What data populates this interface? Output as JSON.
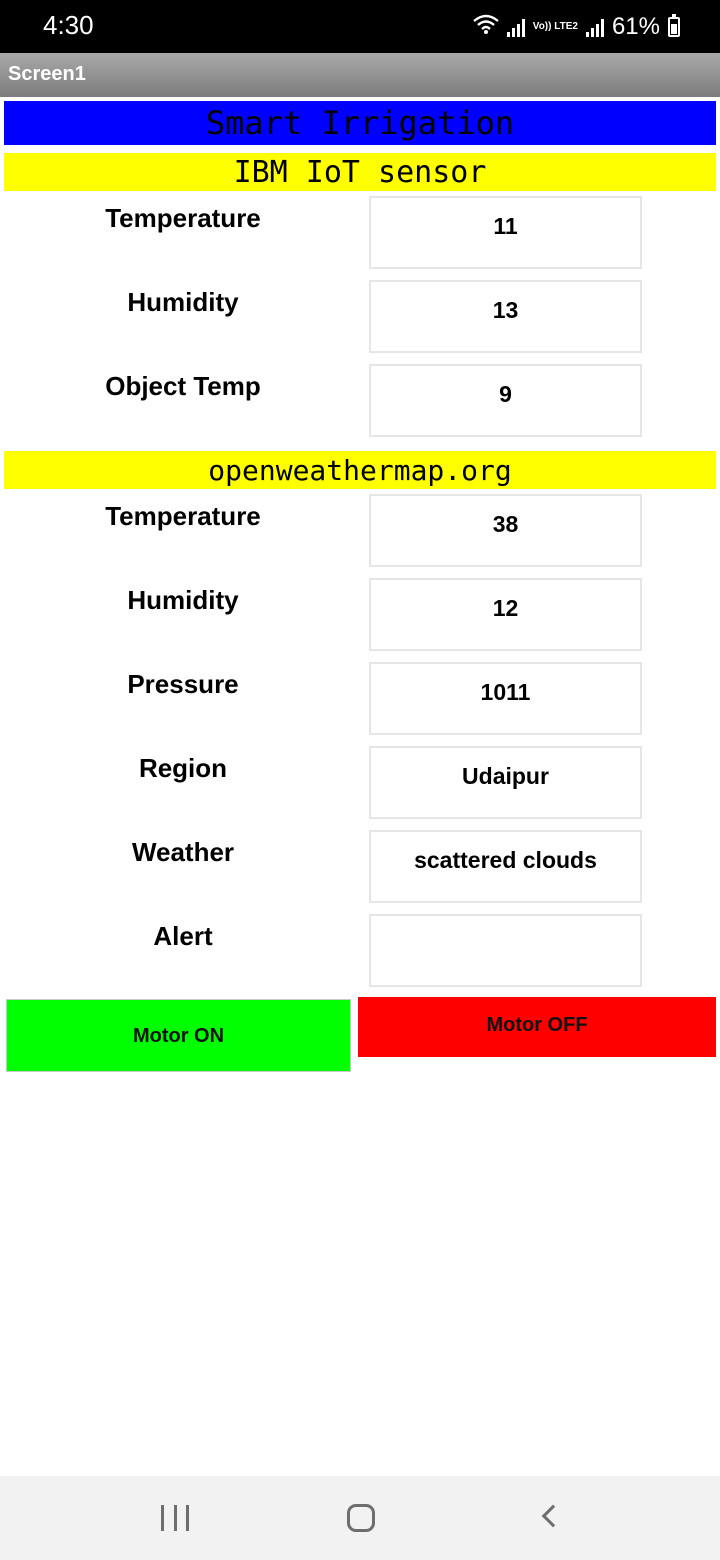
{
  "status_bar": {
    "time": "4:30",
    "network_label": "Vo)) LTE2",
    "battery": "61%"
  },
  "title_bar": {
    "title": "Screen1"
  },
  "header": {
    "title": "Smart Irrigation",
    "title_bg": "#0000ff"
  },
  "iot_section": {
    "title": "IBM IoT sensor",
    "bg": "#ffff00",
    "rows": [
      {
        "label": "Temperature",
        "value": "11"
      },
      {
        "label": "Humidity",
        "value": "13"
      },
      {
        "label": "Object Temp",
        "value": "9"
      }
    ]
  },
  "weather_section": {
    "title": "openweathermap.org",
    "bg": "#ffff00",
    "rows": [
      {
        "label": "Temperature",
        "value": "38"
      },
      {
        "label": "Humidity",
        "value": "12"
      },
      {
        "label": "Pressure",
        "value": "1011"
      },
      {
        "label": "Region",
        "value": "Udaipur"
      },
      {
        "label": "Weather",
        "value": "scattered clouds"
      },
      {
        "label": "Alert",
        "value": ""
      }
    ]
  },
  "buttons": {
    "motor_on": {
      "label": "Motor ON",
      "color": "#00ff00"
    },
    "motor_off": {
      "label": "Motor OFF",
      "color": "#ff0000"
    }
  },
  "icons": {
    "wifi": "wifi-icon",
    "signal": "signal-icon",
    "battery": "battery-icon",
    "recent": "recent-apps-icon",
    "home": "home-icon",
    "back": "back-icon"
  }
}
